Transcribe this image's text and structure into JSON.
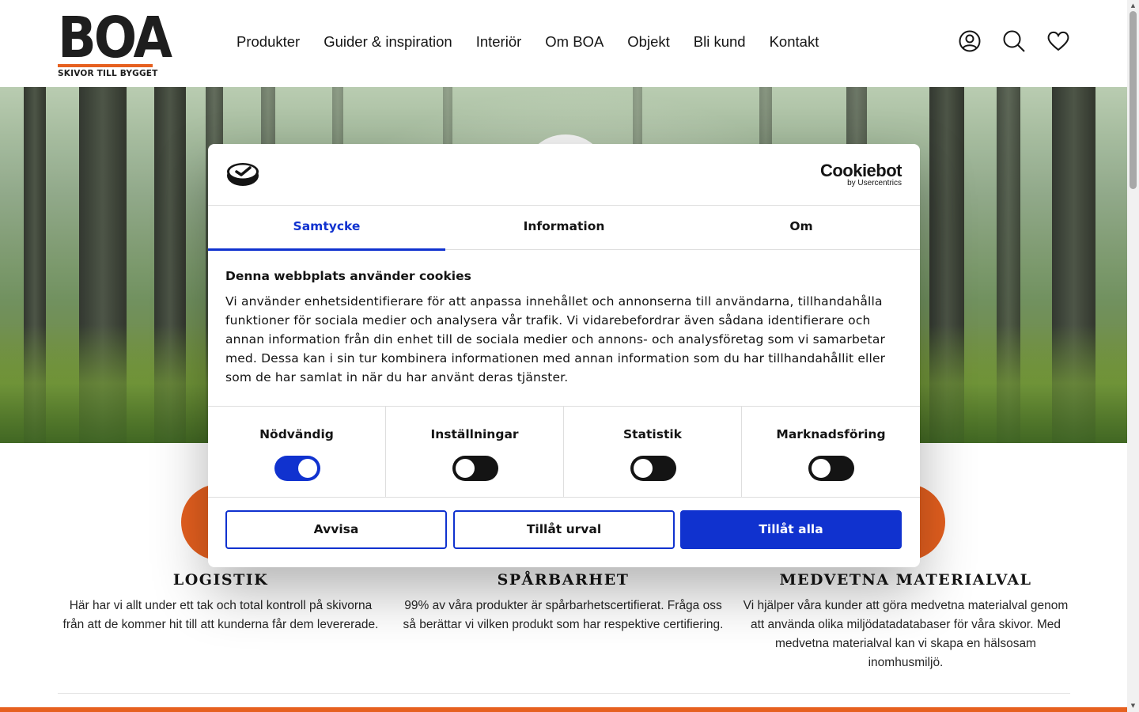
{
  "header": {
    "logo_text": "BOA",
    "logo_tagline": "SKIVOR TILL BYGGET",
    "nav": [
      "Produkter",
      "Guider & inspiration",
      "Interiör",
      "Om BOA",
      "Objekt",
      "Bli kund",
      "Kontakt"
    ],
    "icons": [
      "user-icon",
      "search-icon",
      "heart-icon"
    ]
  },
  "features": [
    {
      "title": "LOGISTIK",
      "text": "Här har vi allt under ett tak och total kontroll på skivorna från att de kommer hit till att kunderna får dem levererade."
    },
    {
      "title": "SPÅRBARHET",
      "text": "99% av våra produkter är spårbarhetscertifierat. Fråga oss så berättar vi vilken produkt som har respektive certifiering."
    },
    {
      "title": "MEDVETNA MATERIALVAL",
      "text": "Vi hjälper våra kunder att göra medvetna materialval genom att använda olika miljödatadatabaser för våra skivor. Med medvetna materialval kan vi skapa en hälsosam inomhusmiljö."
    }
  ],
  "cookie_dialog": {
    "brand_name": "Cookiebot",
    "brand_sub": "by Usercentrics",
    "tabs": [
      "Samtycke",
      "Information",
      "Om"
    ],
    "active_tab": "Samtycke",
    "heading": "Denna webbplats använder cookies",
    "body": "Vi använder enhetsidentifierare för att anpassa innehållet och annonserna till användarna, tillhandahålla funktioner för sociala medier och analysera vår trafik. Vi vidarebefordrar även sådana identifierare och annan information från din enhet till de sociala medier och annons- och analysföretag som vi samarbetar med. Dessa kan i sin tur kombinera informationen med annan information som du har tillhandahållit eller som de har samlat in när du har använt deras tjänster.",
    "categories": [
      {
        "label": "Nödvändig",
        "enabled": true
      },
      {
        "label": "Inställningar",
        "enabled": false
      },
      {
        "label": "Statistik",
        "enabled": false
      },
      {
        "label": "Marknadsföring",
        "enabled": false
      }
    ],
    "buttons": {
      "deny": "Avvisa",
      "allow_selection": "Tillåt urval",
      "allow_all": "Tillåt alla"
    }
  },
  "colors": {
    "brand_orange": "#e65d1b",
    "cookiebot_blue": "#1032cf",
    "text_dark": "#141414"
  }
}
